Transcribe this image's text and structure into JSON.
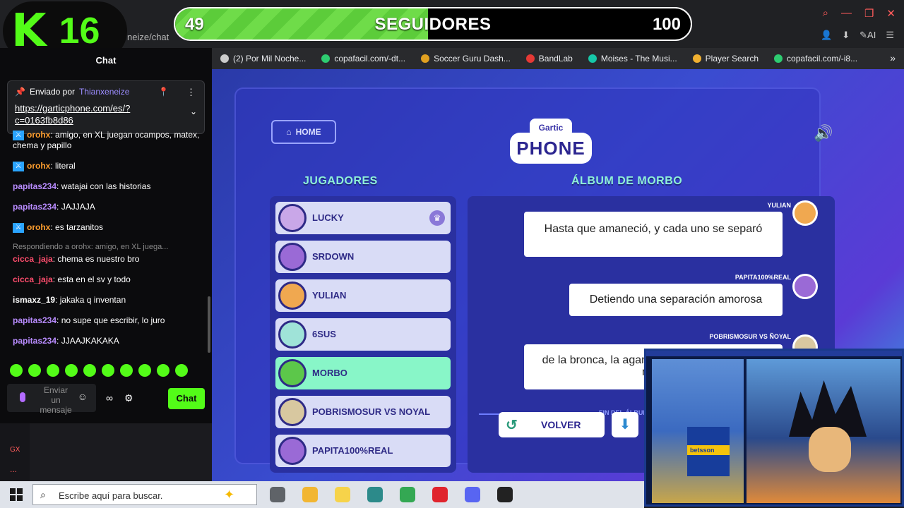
{
  "kick_overlay": {
    "logo_letter": "K",
    "logo_number": "16"
  },
  "follower_bar": {
    "current": "49",
    "label": "SEGUIDORES",
    "goal": "100",
    "progress": 0.49
  },
  "browser": {
    "url_fragment": "neize/chat",
    "bookmarks": [
      {
        "label": "(2) Por Mil Noche...",
        "color": "#cccccc"
      },
      {
        "label": "copafacil.com/-dt...",
        "color": "#2ecc71"
      },
      {
        "label": "Soccer Guru Dash...",
        "color": "#e0a020"
      },
      {
        "label": "BandLab",
        "color": "#e53935"
      },
      {
        "label": "Moises - The Musi...",
        "color": "#16c7a8"
      },
      {
        "label": "Player Search",
        "color": "#f0b030"
      },
      {
        "label": "copafacil.com/-i8...",
        "color": "#2ecc71"
      }
    ],
    "bookmarks_more": "»",
    "window_controls": [
      "⌕",
      "—",
      "❐",
      "✕"
    ],
    "ext_ai_label": "AI"
  },
  "chat": {
    "title": "Chat",
    "pinned": {
      "sent_by": "Enviado por",
      "user": "Thianxeneize",
      "link": "https://garticphone.com/es/?c=0163fb8d86"
    },
    "messages": [
      {
        "user": "orohx",
        "mod": true,
        "color": "#ff9f2e",
        "text": "amigo, en XL juegan ocampos, matex, chema y papillo",
        "reply": ""
      },
      {
        "user": "orohx",
        "mod": true,
        "color": "#ff9f2e",
        "text": "literal",
        "reply": ""
      },
      {
        "user": "papitas234",
        "mod": false,
        "color": "#b98cff",
        "text": "watajai con las historias",
        "reply": ""
      },
      {
        "user": "papitas234",
        "mod": false,
        "color": "#b98cff",
        "text": "JAJJAJA",
        "reply": ""
      },
      {
        "user": "orohx",
        "mod": true,
        "color": "#ff9f2e",
        "text": "es tarzanitos",
        "reply": ""
      },
      {
        "user": "cicca_jaja",
        "mod": false,
        "color": "#ff4d6d",
        "text": "chema es nuestro bro",
        "reply": "Respondiendo a orohx: amigo, en XL juega..."
      },
      {
        "user": "cicca_jaja",
        "mod": false,
        "color": "#ff4d6d",
        "text": "esta en el sv y todo",
        "reply": ""
      },
      {
        "user": "ismaxz_19",
        "mod": false,
        "color": "#ffffff",
        "text": "jakaka q inventan",
        "reply": ""
      },
      {
        "user": "papitas234",
        "mod": false,
        "color": "#b98cff",
        "text": "no supe que escribir, lo juro",
        "reply": ""
      },
      {
        "user": "papitas234",
        "mod": false,
        "color": "#b98cff",
        "text": "JJAAJKAKAKA",
        "reply": ""
      }
    ],
    "input_placeholder": "Enviar un mensaje",
    "send_label": "Chat"
  },
  "left_strip": {
    "label": "GX",
    "dots": "..."
  },
  "game": {
    "home_label": "HOME",
    "logo_top": "Gartic",
    "logo_main": "PHONE",
    "players_title": "JUGADORES",
    "album_title": "ÁLBUM DE MORBO",
    "players": [
      {
        "name": "LUCKY",
        "avatar_color": "#c9a7e8",
        "selected": false,
        "owner": true
      },
      {
        "name": "SRDOWN",
        "avatar_color": "#9a6ad6",
        "selected": false,
        "owner": false
      },
      {
        "name": "YULIAN",
        "avatar_color": "#f0a850",
        "selected": false,
        "owner": false
      },
      {
        "name": "6SUS",
        "avatar_color": "#9fe3d8",
        "selected": false,
        "owner": false
      },
      {
        "name": "MORBO",
        "avatar_color": "#5cc74a",
        "selected": true,
        "owner": false
      },
      {
        "name": "POBRISMOSUR VS NOYAL",
        "avatar_color": "#d8c8a0",
        "selected": false,
        "owner": false
      },
      {
        "name": "PAPITA100%REAL",
        "avatar_color": "#9a6ad6",
        "selected": false,
        "owner": false
      }
    ],
    "album": [
      {
        "author": "YULIAN",
        "text": "Hasta que amaneció, y cada uno se separó",
        "avatar_color": "#f0a850"
      },
      {
        "author": "PAPITA100%REAL",
        "text": "Detiendo una separación amorosa",
        "avatar_color": "#9a6ad6"
      },
      {
        "author": "POBRISMOSUR VS ÑOYAL",
        "text": "de la bronca, la agarró a machetazos y se la mort",
        "avatar_color": "#d8c8a0"
      }
    ],
    "album_end": "FIN DEL ÁLBUM DE",
    "back_label": "VOLVER"
  },
  "webcam": {
    "jersey_text": "betsson"
  },
  "taskbar": {
    "search_placeholder": "Escribe aquí para buscar.",
    "apps": [
      {
        "name": "task-view",
        "color": "#5f6368"
      },
      {
        "name": "file-explorer",
        "color": "#f2b632"
      },
      {
        "name": "notes",
        "color": "#f6d34a"
      },
      {
        "name": "app-store",
        "color": "#2c8a8a"
      },
      {
        "name": "chrome",
        "color": "#34a853"
      },
      {
        "name": "opera",
        "color": "#e0242d"
      },
      {
        "name": "discord",
        "color": "#5865f2"
      },
      {
        "name": "obs",
        "color": "#222222"
      }
    ]
  }
}
